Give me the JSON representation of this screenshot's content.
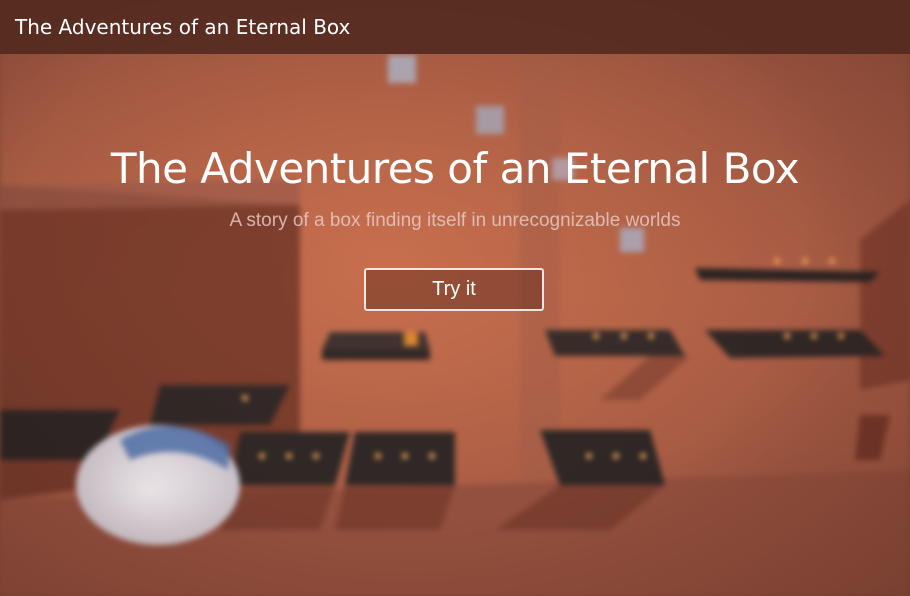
{
  "window": {
    "title": "The Adventures of an Eternal Box"
  },
  "hero": {
    "title": "The Adventures of an Eternal Box",
    "subtitle": "A story of a box finding itself in unrecognizable worlds",
    "cta_label": "Try it"
  },
  "colors": {
    "background": "#8a4a37",
    "titlebar": "#542a20",
    "button_border": "#f2e4df"
  }
}
